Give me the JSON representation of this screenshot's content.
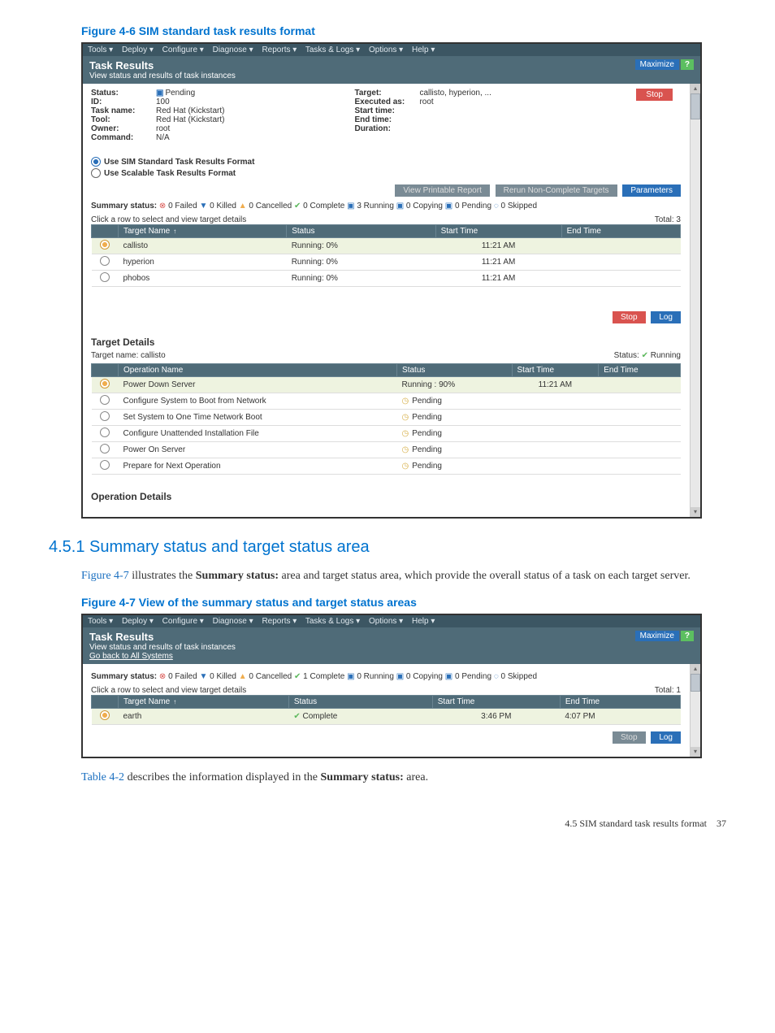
{
  "doc": {
    "fig46_caption": "Figure 4-6 SIM standard task results format",
    "section_num": "4.5.1",
    "section_title": "Summary status and target status area",
    "section_para_prefix": "Figure 4-7",
    "section_para_mid": " illustrates the ",
    "section_para_bold": "Summary status:",
    "section_para_suffix": " area and target status area, which provide the overall status of a task on each target server.",
    "fig47_caption": "Figure 4-7 View of the summary status and target status areas",
    "table_ref_prefix": "Table 4-2",
    "table_ref_mid": " describes the information displayed in the ",
    "table_ref_bold": "Summary status:",
    "table_ref_suffix": " area.",
    "footer_text": "4.5 SIM standard task results format",
    "footer_page": "37"
  },
  "fig46": {
    "menubar": [
      "Tools ▾",
      "Deploy ▾",
      "Configure ▾",
      "Diagnose ▾",
      "Reports ▾",
      "Tasks & Logs ▾",
      "Options ▾",
      "Help ▾"
    ],
    "title": "Task Results",
    "subtitle": "View status and results of task instances",
    "maximize": "Maximize",
    "help_q": "?",
    "left_info": [
      {
        "label": "Status:",
        "value": "Pending",
        "pending_icon": true
      },
      {
        "label": "ID:",
        "value": "100"
      },
      {
        "label": "Task name:",
        "value": "Red Hat (Kickstart)"
      },
      {
        "label": "Tool:",
        "value": "Red Hat (Kickstart)"
      },
      {
        "label": "Owner:",
        "value": "root"
      },
      {
        "label": "Command:",
        "value": "N/A"
      }
    ],
    "mid_info": [
      {
        "label": "Target:",
        "value": "callisto, hyperion, ..."
      },
      {
        "label": "Executed as:",
        "value": "root"
      },
      {
        "label": "Start time:",
        "value": ""
      },
      {
        "label": "End time:",
        "value": ""
      },
      {
        "label": "Duration:",
        "value": ""
      }
    ],
    "stop": "Stop",
    "radio1": "Use SIM Standard Task Results Format",
    "radio2": "Use Scalable Task Results Format",
    "view_report": "View Printable Report",
    "rerun": "Rerun Non-Complete Targets",
    "parameters": "Parameters",
    "summary_lead": "Summary status:",
    "summary_parts": [
      {
        "cls": "icon-red",
        "sym": "⊗",
        "text": " 0 Failed "
      },
      {
        "cls": "icon-blue",
        "sym": "▼",
        "text": " 0 Killed "
      },
      {
        "cls": "icon-yellow",
        "sym": "▲",
        "text": " 0 Cancelled "
      },
      {
        "cls": "icon-green",
        "sym": "✔",
        "text": " 0 Complete "
      },
      {
        "cls": "icon-blue",
        "sym": "▣",
        "text": " 3 Running "
      },
      {
        "cls": "icon-blue",
        "sym": "▣",
        "text": " 0 Copying "
      },
      {
        "cls": "icon-blue",
        "sym": "▣",
        "text": " 0 Pending "
      },
      {
        "cls": "icon-blue",
        "sym": "◌",
        "text": " 0 Skipped"
      }
    ],
    "hint": "Click a row to select and view target details",
    "total": "Total: 3",
    "targets_headers": [
      "",
      "Target Name",
      "Status",
      "Start Time",
      "End Time"
    ],
    "targets": [
      {
        "sel": true,
        "name": "callisto",
        "status": "Running: 0%",
        "start": "11:21 AM",
        "end": ""
      },
      {
        "sel": false,
        "name": "hyperion",
        "status": "Running: 0%",
        "start": "11:21 AM",
        "end": ""
      },
      {
        "sel": false,
        "name": "phobos",
        "status": "Running: 0%",
        "start": "11:21 AM",
        "end": ""
      }
    ],
    "stop2": "Stop",
    "log": "Log",
    "target_details_h": "Target Details",
    "target_name_lbl": "Target name: ",
    "target_name_val": "callisto",
    "status_lbl": "Status: ",
    "status_val": "Running",
    "ops_headers": [
      "",
      "Operation Name",
      "Status",
      "Start Time",
      "End Time"
    ],
    "ops": [
      {
        "sel": true,
        "name": "Power Down Server",
        "status": "Running : 90%",
        "start": "11:21 AM",
        "end": "",
        "icon": ""
      },
      {
        "sel": false,
        "name": "Configure System to Boot from Network",
        "status": "Pending",
        "icon": "clk"
      },
      {
        "sel": false,
        "name": "Set System to One Time Network Boot",
        "status": "Pending",
        "icon": "clk"
      },
      {
        "sel": false,
        "name": "Configure Unattended Installation File",
        "status": "Pending",
        "icon": "clk"
      },
      {
        "sel": false,
        "name": "Power On Server",
        "status": "Pending",
        "icon": "clk"
      },
      {
        "sel": false,
        "name": "Prepare for Next Operation",
        "status": "Pending",
        "icon": "clk"
      }
    ],
    "op_details_h": "Operation Details"
  },
  "fig47": {
    "menubar": [
      "Tools ▾",
      "Deploy ▾",
      "Configure ▾",
      "Diagnose ▾",
      "Reports ▾",
      "Tasks & Logs ▾",
      "Options ▾",
      "Help ▾"
    ],
    "title": "Task Results",
    "subtitle": "View status and results of task instances",
    "go_back": "Go back to All Systems",
    "maximize": "Maximize",
    "help_q": "?",
    "summary_lead": "Summary status:",
    "summary_parts": [
      {
        "cls": "icon-red",
        "sym": "⊗",
        "text": " 0 Failed "
      },
      {
        "cls": "icon-blue",
        "sym": "▼",
        "text": " 0 Killed "
      },
      {
        "cls": "icon-yellow",
        "sym": "▲",
        "text": " 0 Cancelled "
      },
      {
        "cls": "icon-green",
        "sym": "✔",
        "text": " 1 Complete "
      },
      {
        "cls": "icon-blue",
        "sym": "▣",
        "text": " 0 Running "
      },
      {
        "cls": "icon-blue",
        "sym": "▣",
        "text": " 0 Copying "
      },
      {
        "cls": "icon-blue",
        "sym": "▣",
        "text": " 0 Pending "
      },
      {
        "cls": "icon-blue",
        "sym": "◌",
        "text": " 0 Skipped"
      }
    ],
    "hint": "Click a row to select and view target details",
    "total": "Total: 1",
    "headers": [
      "",
      "Target Name",
      "Status",
      "Start Time",
      "End Time"
    ],
    "rows": [
      {
        "sel": true,
        "name": "earth",
        "status": "Complete",
        "icon": "chk",
        "start": "3:46 PM",
        "end": "4:07 PM"
      }
    ],
    "stop": "Stop",
    "log": "Log"
  }
}
